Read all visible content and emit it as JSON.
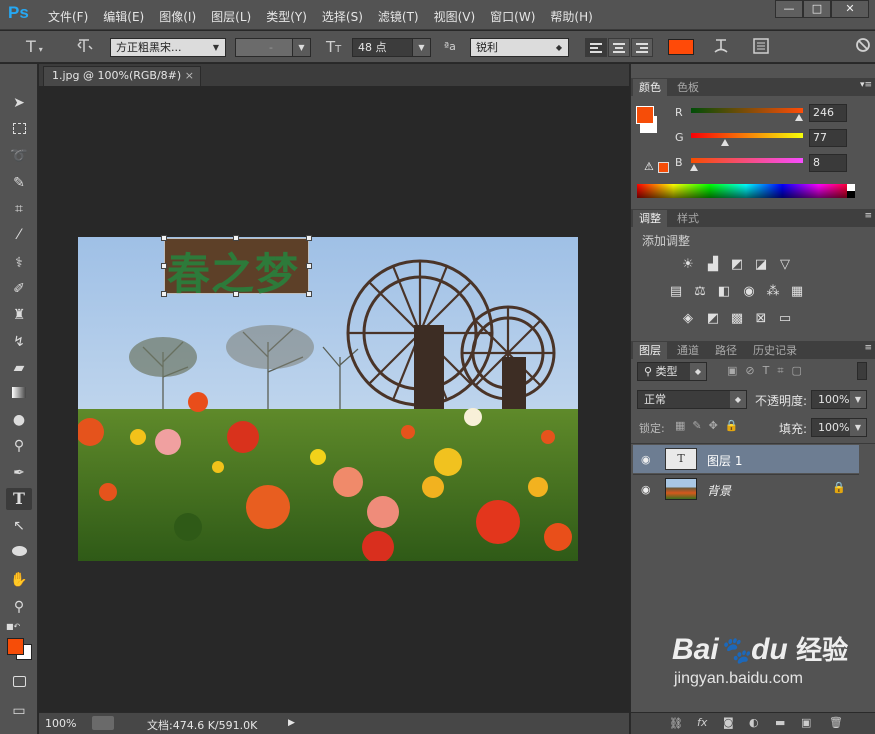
{
  "app": {
    "logo": "Ps"
  },
  "menu": [
    "文件(F)",
    "编辑(E)",
    "图像(I)",
    "图层(L)",
    "类型(Y)",
    "选择(S)",
    "滤镜(T)",
    "视图(V)",
    "窗口(W)",
    "帮助(H)"
  ],
  "window_controls": {
    "minimize": "—",
    "restore": "□",
    "close": "✕"
  },
  "options_bar": {
    "font_family": "方正粗黑宋...",
    "font_style": "-",
    "font_size": "48 点",
    "aa_label": "ªa",
    "antialias": "锐利",
    "text_color": "#ff4a08"
  },
  "document": {
    "tab_title": "1.jpg @ 100%(RGB/8#)",
    "tab_close": "×"
  },
  "canvas": {
    "text_layer_content": "春之梦",
    "text_color": "#2d7a3a",
    "text_bg": "#5d4028"
  },
  "status": {
    "zoom": "100%",
    "doc_info": "文档:474.6 K/591.0K"
  },
  "color_panel": {
    "tabs": [
      "颜色",
      "色板"
    ],
    "channels": [
      {
        "name": "R",
        "value": "246",
        "level": 0.965
      },
      {
        "name": "G",
        "value": "77",
        "level": 0.302
      },
      {
        "name": "B",
        "value": "8",
        "level": 0.031
      }
    ],
    "foreground": "#f64d08",
    "background": "#ffffff"
  },
  "adjust_panel": {
    "tabs": [
      "调整",
      "样式"
    ],
    "title": "添加调整"
  },
  "layers_panel": {
    "tabs": [
      "图层",
      "通道",
      "路径",
      "历史记录"
    ],
    "filter_kind": "类型",
    "blend_mode": "正常",
    "opacity_label": "不透明度:",
    "opacity": "100%",
    "lock_label": "锁定:",
    "fill_label": "填充:",
    "fill": "100%",
    "layers": [
      {
        "name": "图层 1",
        "thumb_label": "T",
        "selected": true
      },
      {
        "name": "背景",
        "selected": false,
        "locked": true
      }
    ]
  },
  "watermark": {
    "brand": "Bai",
    "brand2": "du",
    "brand3": "经验",
    "url": "jingyan.baidu.com"
  }
}
